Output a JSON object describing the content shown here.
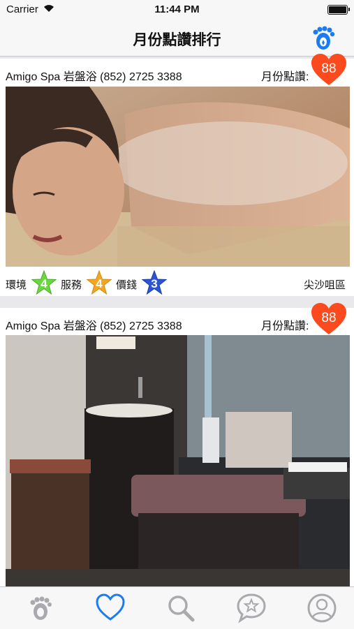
{
  "status_bar": {
    "carrier": "Carrier",
    "time": "11:44 PM"
  },
  "nav": {
    "title": "月份點讚排行",
    "action_icon": "footprints-icon"
  },
  "colors": {
    "heart": "#fb4a1d",
    "accent": "#1b7cf2",
    "star_green": "#6ad640",
    "star_orange": "#f2a623",
    "star_blue": "#2a56d6"
  },
  "cards": [
    {
      "shop_name": "Amigo Spa 岩盤浴 (852) 2725 3388",
      "likes_label": "月份點讚:",
      "likes": "88",
      "ratings": [
        {
          "label": "環境",
          "value": "4",
          "color": "green"
        },
        {
          "label": "服務",
          "value": "4",
          "color": "orange"
        },
        {
          "label": "價錢",
          "value": "3",
          "color": "blue"
        }
      ],
      "district": "尖沙咀區"
    },
    {
      "shop_name": "Amigo Spa 岩盤浴 (852) 2725 3388",
      "likes_label": "月份點讚:",
      "likes": "88"
    }
  ],
  "tabs": [
    {
      "icon": "footprints-icon",
      "active": false
    },
    {
      "icon": "heart-icon",
      "active": true
    },
    {
      "icon": "search-icon",
      "active": false
    },
    {
      "icon": "star-chat-icon",
      "active": false
    },
    {
      "icon": "profile-icon",
      "active": false
    }
  ]
}
